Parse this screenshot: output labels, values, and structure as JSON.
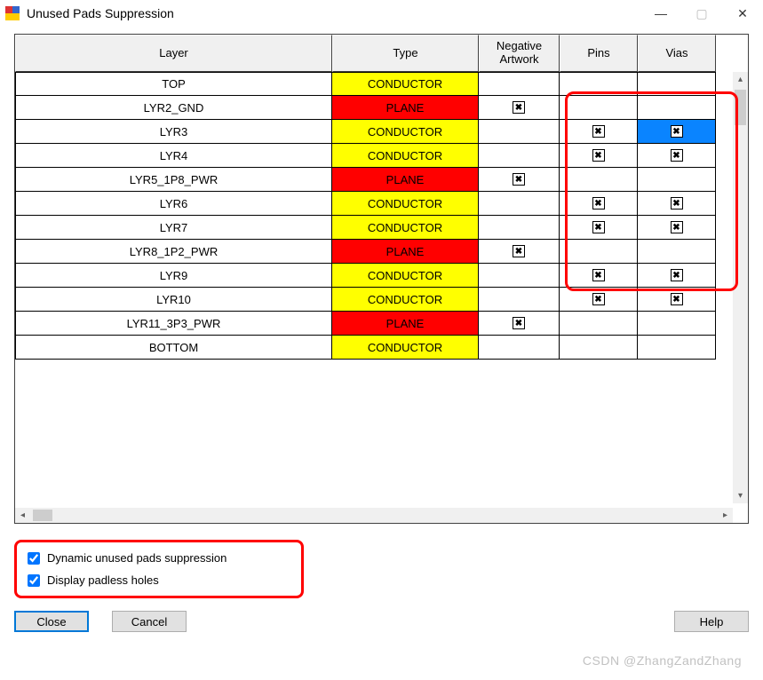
{
  "window": {
    "title": "Unused Pads Suppression"
  },
  "headers": {
    "layer": "Layer",
    "type": "Type",
    "neg": "Negative Artwork",
    "pins": "Pins",
    "vias": "Vias"
  },
  "rows": [
    {
      "layer": "TOP",
      "type": "CONDUCTOR",
      "typeClass": "conductor",
      "neg": false,
      "pins": false,
      "vias": false,
      "viasHl": false
    },
    {
      "layer": "LYR2_GND",
      "type": "PLANE",
      "typeClass": "plane",
      "neg": true,
      "pins": false,
      "vias": false,
      "viasHl": false
    },
    {
      "layer": "LYR3",
      "type": "CONDUCTOR",
      "typeClass": "conductor",
      "neg": false,
      "pins": true,
      "vias": true,
      "viasHl": true
    },
    {
      "layer": "LYR4",
      "type": "CONDUCTOR",
      "typeClass": "conductor",
      "neg": false,
      "pins": true,
      "vias": true,
      "viasHl": false
    },
    {
      "layer": "LYR5_1P8_PWR",
      "type": "PLANE",
      "typeClass": "plane",
      "neg": true,
      "pins": false,
      "vias": false,
      "viasHl": false
    },
    {
      "layer": "LYR6",
      "type": "CONDUCTOR",
      "typeClass": "conductor",
      "neg": false,
      "pins": true,
      "vias": true,
      "viasHl": false
    },
    {
      "layer": "LYR7",
      "type": "CONDUCTOR",
      "typeClass": "conductor",
      "neg": false,
      "pins": true,
      "vias": true,
      "viasHl": false
    },
    {
      "layer": "LYR8_1P2_PWR",
      "type": "PLANE",
      "typeClass": "plane",
      "neg": true,
      "pins": false,
      "vias": false,
      "viasHl": false
    },
    {
      "layer": "LYR9",
      "type": "CONDUCTOR",
      "typeClass": "conductor",
      "neg": false,
      "pins": true,
      "vias": true,
      "viasHl": false
    },
    {
      "layer": "LYR10",
      "type": "CONDUCTOR",
      "typeClass": "conductor",
      "neg": false,
      "pins": true,
      "vias": true,
      "viasHl": false
    },
    {
      "layer": "LYR11_3P3_PWR",
      "type": "PLANE",
      "typeClass": "plane",
      "neg": true,
      "pins": false,
      "vias": false,
      "viasHl": false
    },
    {
      "layer": "BOTTOM",
      "type": "CONDUCTOR",
      "typeClass": "conductor",
      "neg": false,
      "pins": false,
      "vias": false,
      "viasHl": false
    }
  ],
  "options": {
    "dynamic": {
      "label": "Dynamic unused pads suppression",
      "checked": true
    },
    "padless": {
      "label": "Display padless holes",
      "checked": true
    }
  },
  "buttons": {
    "close": "Close",
    "cancel": "Cancel",
    "help": "Help"
  },
  "watermark": "CSDN @ZhangZandZhang"
}
